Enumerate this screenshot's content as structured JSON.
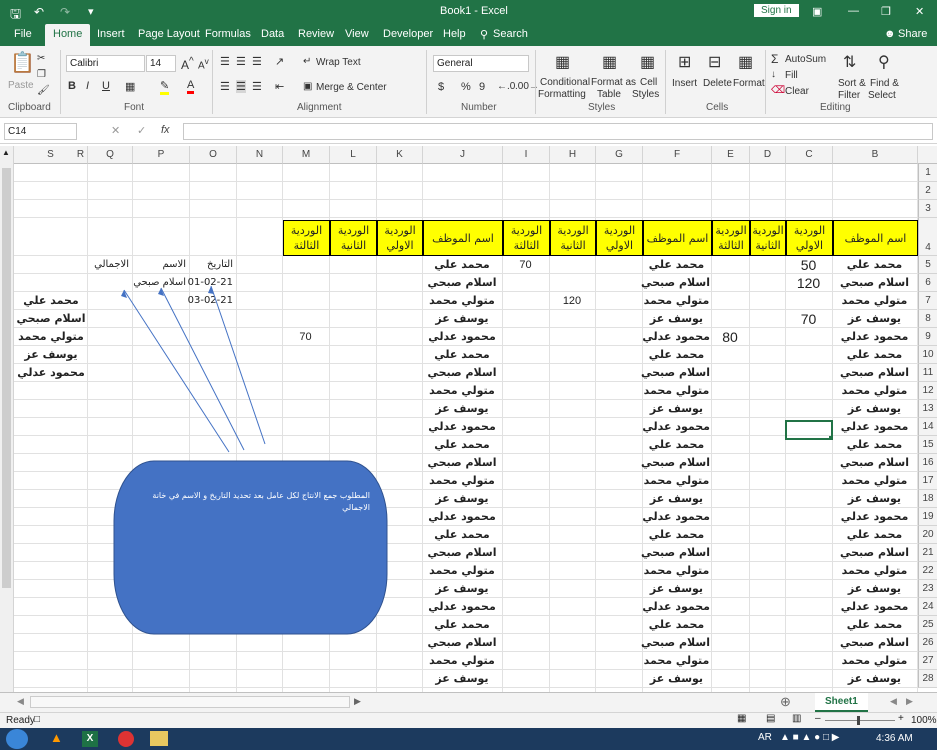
{
  "title": {
    "book": "Book1 - Excel",
    "sign_in": "Sign in"
  },
  "tabs": [
    "File",
    "Home",
    "Insert",
    "Page Layout",
    "Formulas",
    "Data",
    "Review",
    "View",
    "Developer",
    "Help"
  ],
  "search_label": "Search",
  "share_label": "Share",
  "ribbon": {
    "paste": "Paste",
    "font_name": "Calibri",
    "font_size": "14",
    "wrap_text": "Wrap Text",
    "merge_center": "Merge & Center",
    "number_format": "General",
    "currency": "$",
    "percent": "%",
    "comma": "9",
    "conditional": "Conditional",
    "formatting": "Formatting",
    "format_as": "Format as",
    "table": "Table",
    "cell": "Cell",
    "styles": "Styles",
    "insert": "Insert",
    "delete": "Delete",
    "format": "Format",
    "autosum": "AutoSum",
    "fill": "Fill",
    "clear": "Clear",
    "sort_filter_1": "Sort &",
    "sort_filter_2": "Filter",
    "find_select_1": "Find &",
    "find_select_2": "Select",
    "groups": [
      "Clipboard",
      "Font",
      "Alignment",
      "Number",
      "Styles",
      "Cells",
      "Editing"
    ]
  },
  "formula_bar": {
    "name_box": "C14",
    "fx": "fx",
    "value": ""
  },
  "columns": [
    "S",
    "R",
    "Q",
    "P",
    "O",
    "N",
    "M",
    "L",
    "K",
    "J",
    "I",
    "H",
    "G",
    "F",
    "E",
    "D",
    "C",
    "B"
  ],
  "rows": [
    "1",
    "2",
    "3",
    "4",
    "5",
    "6",
    "7",
    "8",
    "9",
    "10",
    "11",
    "12",
    "13",
    "14",
    "15",
    "16",
    "17",
    "18",
    "19",
    "20",
    "21",
    "22",
    "23",
    "24",
    "25",
    "26",
    "27",
    "28"
  ],
  "headers": {
    "name": "اسم الموظف",
    "shift1": "الوردية الاولي",
    "shift2": "الوردية الثانية",
    "shift3": "الوردية الثالثة"
  },
  "names_cycle": [
    "محمد علي",
    "اسلام صبحي",
    "متولي محمد",
    "يوسف عز",
    "محمود عدلي"
  ],
  "values": {
    "c5": "50",
    "c6": "120",
    "c8": "70",
    "e9": "80",
    "i5": "70",
    "h7": "120",
    "m9": "70"
  },
  "lookup": {
    "date_label": "التاريخ",
    "name_label": "الاسم",
    "total_label": "الاجمالي",
    "date1": "01-02-21",
    "name1": "اسلام صبحي",
    "date2": "03-02-21"
  },
  "s_list": [
    "محمد علي",
    "اسلام صبحي",
    "متولي محمد",
    "يوسف عز",
    "محمود عدلي"
  ],
  "note": "المطلوب جمع الانتاج لكل عامل بعد تحديد التاريخ و الاسم في خانة الاجمالي",
  "sheet_tab": "Sheet1",
  "status": {
    "ready": "Ready",
    "zoom": "100%"
  },
  "taskbar": {
    "lang": "AR",
    "time": "4:36 AM"
  }
}
